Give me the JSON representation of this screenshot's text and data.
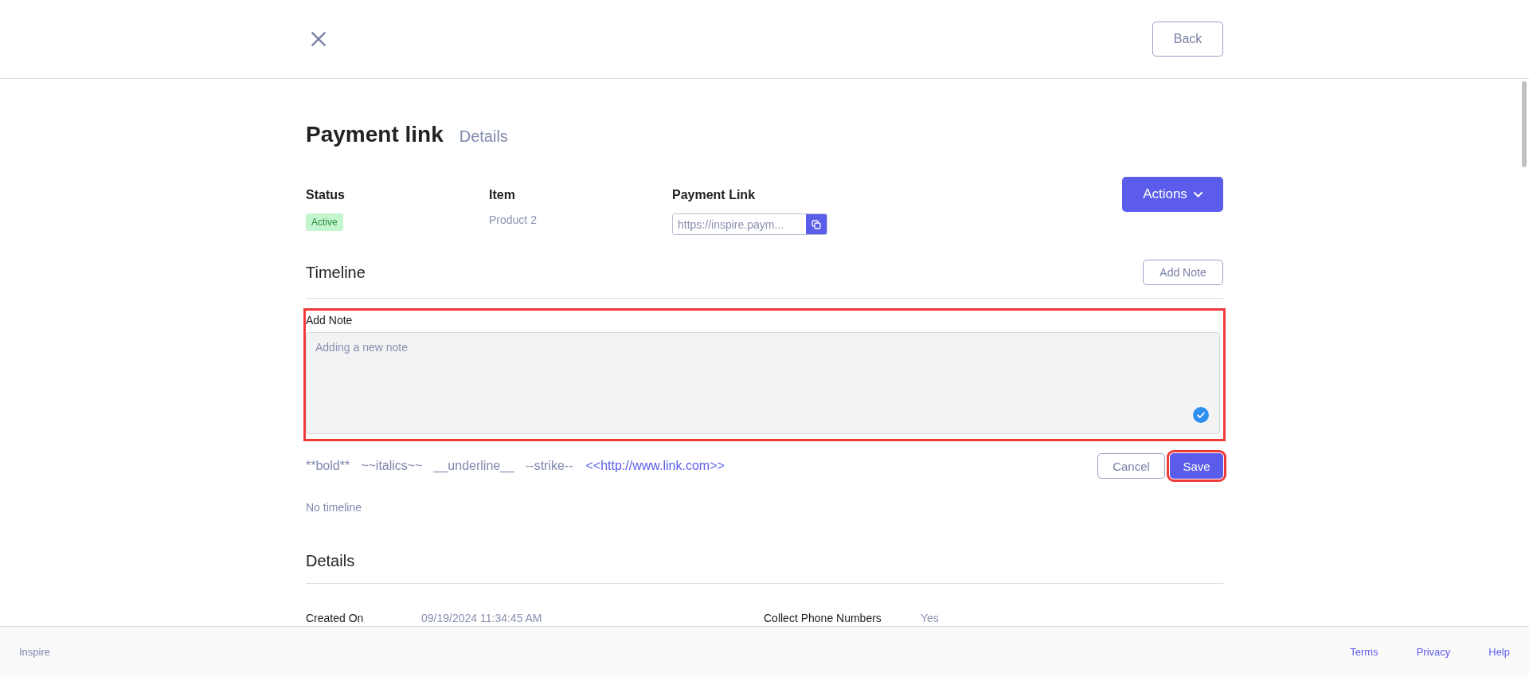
{
  "header": {
    "back_button": "Back"
  },
  "page": {
    "title": "Payment link",
    "subtitle": "Details"
  },
  "summary": {
    "fields": [
      {
        "kind": "badge",
        "label": "Status",
        "value": "Active"
      },
      {
        "kind": "text",
        "label": "Item",
        "value": "Product 2"
      },
      {
        "kind": "link",
        "label": "Payment Link",
        "value": "https://inspire.paym..."
      }
    ],
    "actions_button": "Actions"
  },
  "timeline": {
    "title": "Timeline",
    "add_note_button": "Add Note",
    "note_editor": {
      "label": "Add Note",
      "placeholder": "Adding a new note",
      "highlighted": true
    },
    "format_hints": [
      {
        "kind": "plain",
        "text": "**bold**"
      },
      {
        "kind": "plain",
        "text": "~~italics~~"
      },
      {
        "kind": "plain",
        "text": "__underline__"
      },
      {
        "kind": "plain",
        "text": "--strike--"
      },
      {
        "kind": "link",
        "text": "<<http://www.link.com>>"
      }
    ],
    "buttons": [
      {
        "label": "Cancel",
        "kind": "secondary",
        "highlighted": false
      },
      {
        "label": "Save",
        "kind": "primary",
        "highlighted": true
      }
    ],
    "empty_text": "No timeline"
  },
  "details": {
    "title": "Details",
    "rows": [
      {
        "label": "Created On",
        "value": "09/19/2024 11:34:45 AM"
      },
      {
        "label": "Collect Phone Numbers",
        "value": "Yes"
      }
    ]
  },
  "footer": {
    "brand": "Inspire",
    "links": [
      "Terms",
      "Privacy",
      "Help"
    ]
  }
}
